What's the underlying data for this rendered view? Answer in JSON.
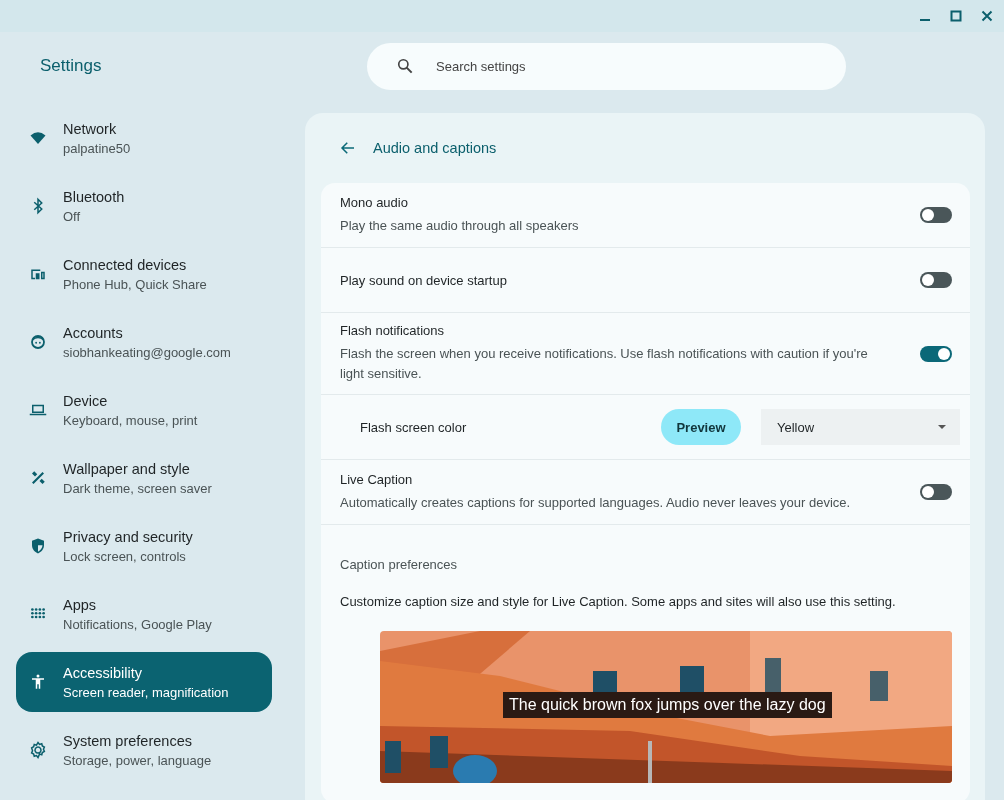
{
  "window": {
    "title": "Settings"
  },
  "search": {
    "placeholder": "Search settings"
  },
  "sidebar": {
    "items": [
      {
        "label": "Network",
        "sublabel": "palpatine50",
        "selected": false
      },
      {
        "label": "Bluetooth",
        "sublabel": "Off",
        "selected": false
      },
      {
        "label": "Connected devices",
        "sublabel": "Phone Hub, Quick Share",
        "selected": false
      },
      {
        "label": "Accounts",
        "sublabel": "siobhankeating@google.com",
        "selected": false
      },
      {
        "label": "Device",
        "sublabel": "Keyboard, mouse, print",
        "selected": false
      },
      {
        "label": "Wallpaper and style",
        "sublabel": "Dark theme, screen saver",
        "selected": false
      },
      {
        "label": "Privacy and security",
        "sublabel": "Lock screen, controls",
        "selected": false
      },
      {
        "label": "Apps",
        "sublabel": "Notifications, Google Play",
        "selected": false
      },
      {
        "label": "Accessibility",
        "sublabel": "Screen reader, magnification",
        "selected": true
      },
      {
        "label": "System preferences",
        "sublabel": "Storage, power, language",
        "selected": false
      }
    ]
  },
  "page": {
    "title": "Audio and captions"
  },
  "settings": [
    {
      "kind": "toggle",
      "title": "Mono audio",
      "description": "Play the same audio through all speakers",
      "on": false
    },
    {
      "kind": "toggle",
      "title": "Play sound on device startup",
      "on": false
    },
    {
      "kind": "toggle",
      "title": "Flash notifications",
      "description": "Flash the screen when you receive notifications. Use flash notifications with caution if you're light sensitive.",
      "on": true
    },
    {
      "kind": "select",
      "title": "Flash screen color",
      "button": "Preview",
      "value": "Yellow"
    },
    {
      "kind": "toggle",
      "title": "Live Caption",
      "description": "Automatically creates captions for supported languages. Audio never leaves your device.",
      "on": false
    }
  ],
  "caption_preferences": {
    "heading": "Caption preferences",
    "description": "Customize caption size and style for Live Caption. Some apps and sites will also use this setting.",
    "preview": {
      "kind": "picture",
      "caption": "The quick brown fox jumps over the lazy dog"
    }
  }
}
